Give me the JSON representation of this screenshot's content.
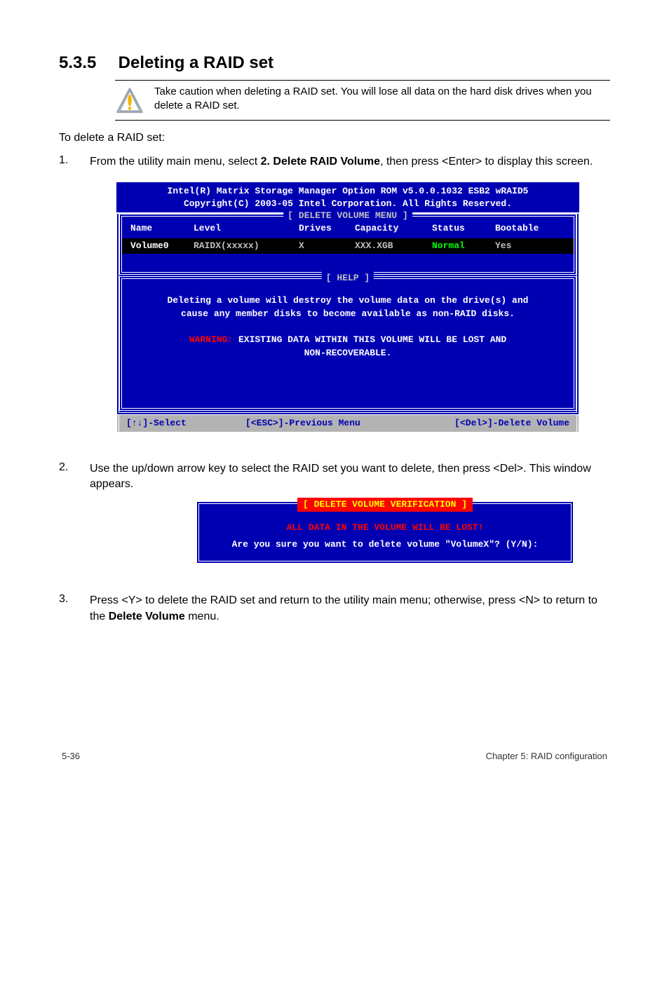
{
  "section": {
    "number": "5.3.5",
    "title": "Deleting a RAID set"
  },
  "caution": {
    "text": "Take caution when deleting a RAID set. You will lose all data on the hard disk drives when you delete a RAID set."
  },
  "intro": "To delete a RAID set:",
  "steps": [
    "From the utility main menu, select 2. Delete RAID Volume, then press <Enter> to display this screen.",
    "Use the up/down arrow key to select the RAID set you want to delete, then press <Del>. This window appears.",
    "Press <Y> to delete the RAID set and return to the utility main menu; otherwise, press <N> to return to the Delete Volume menu."
  ],
  "step1_rich": {
    "pre": "From the utility main menu, select ",
    "bold": "2. Delete RAID Volume",
    "post": ", then press <Enter> to display this screen."
  },
  "step3_rich": {
    "pre": "Press <Y> to delete the RAID set and return to the utility main menu; otherwise, press <N> to return to the ",
    "bold": "Delete Volume",
    "post": " menu."
  },
  "terminal": {
    "header_l1": "Intel(R) Matrix Storage Manager Option ROM v5.0.0.1032 ESB2 wRAID5",
    "header_l2": "Copyright(C) 2003-05 Intel Corporation. All Rights Reserved.",
    "delete_menu_legend": "[ DELETE VOLUME MENU ]",
    "columns": {
      "name": "Name",
      "level": "Level",
      "drives": "Drives",
      "capacity": "Capacity",
      "status": "Status",
      "bootable": "Bootable"
    },
    "row": {
      "name": "Volume0",
      "level": "RAIDX(xxxxx)",
      "drives": "X",
      "capacity": "XXX.XGB",
      "status": "Normal",
      "bootable": "Yes"
    },
    "help_legend": "[ HELP ]",
    "help_l1": "Deleting a volume will destroy the volume data on the drive(s) and",
    "help_l2": "cause any member disks to become available as non-RAID disks.",
    "help_warn_prefix": "WARNING:",
    "help_warn_rest": " EXISTING DATA WITHIN THIS VOLUME WILL BE LOST AND",
    "help_warn_l2": "NON-RECOVERABLE.",
    "footer_select": "[↑↓]-Select",
    "footer_prev": "[<ESC>]-Previous Menu",
    "footer_del": "[<Del>]-Delete Volume"
  },
  "dialog": {
    "title": "[ DELETE VOLUME VERIFICATION ]",
    "warn": "ALL DATA IN THE VOLUME WILL BE LOST!",
    "question": "Are you sure you want to delete volume \"VolumeX\"? (Y/N):"
  },
  "footer": {
    "left": "5-36",
    "right": "Chapter 5: RAID configuration"
  }
}
